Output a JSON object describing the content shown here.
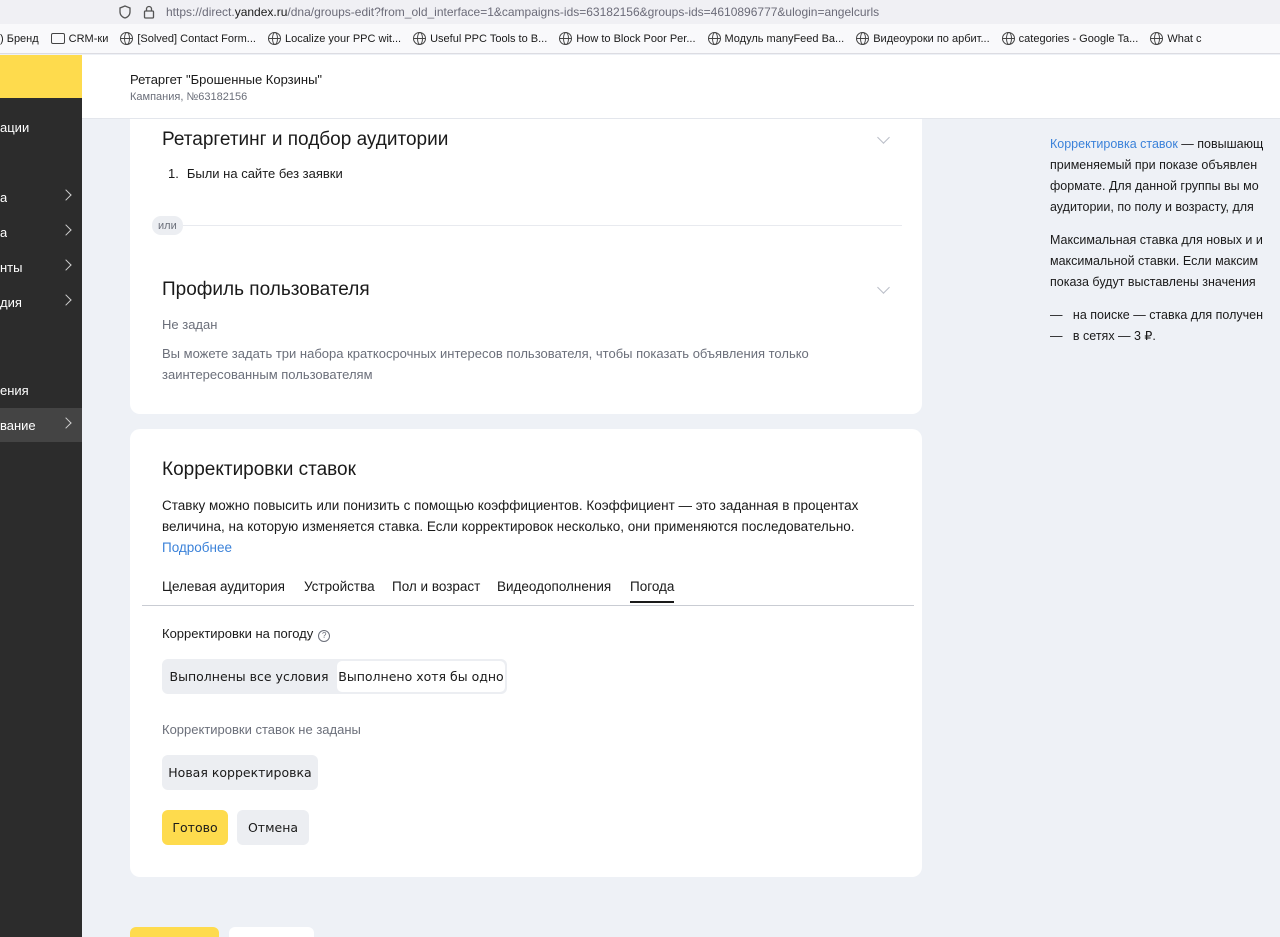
{
  "browser": {
    "url_prefix": "https://direct.",
    "url_host": "yandex.ru",
    "url_rest": "/dna/groups-edit?from_old_interface=1&campaigns-ids=63182156&groups-ids=4610896777&ulogin=angelcurls",
    "bookmarks": [
      {
        "label": ") Бренд",
        "icon": "none"
      },
      {
        "label": "CRM-ки",
        "icon": "folder"
      },
      {
        "label": "[Solved] Contact Form...",
        "icon": "globe"
      },
      {
        "label": "Localize your PPC wit...",
        "icon": "globe"
      },
      {
        "label": "Useful PPC Tools to B...",
        "icon": "globe"
      },
      {
        "label": "How to Block Poor Per...",
        "icon": "globe"
      },
      {
        "label": "Модуль manyFeed Ba...",
        "icon": "globe"
      },
      {
        "label": "Видеоуроки по арбит...",
        "icon": "globe"
      },
      {
        "label": "categories - Google Ta...",
        "icon": "globe"
      },
      {
        "label": "What c",
        "icon": "globe"
      }
    ]
  },
  "sidebar": {
    "items": [
      {
        "label": "ации",
        "chevron": false
      },
      {
        "label": "а",
        "chevron": true
      },
      {
        "label": "а",
        "chevron": true
      },
      {
        "label": "нты",
        "chevron": true
      },
      {
        "label": "дия",
        "chevron": true
      },
      {
        "label": "ения",
        "chevron": false
      },
      {
        "label": "вание",
        "chevron": true
      }
    ]
  },
  "header": {
    "title": "Ретаргет \"Брошенные Корзины\"",
    "subtitle": "Кампания, №63182156"
  },
  "retargeting": {
    "heading": "Ретаргетинг и подбор аудитории",
    "item_number": "1.",
    "item_text": "Были на сайте без заявки",
    "or_label": "или"
  },
  "profile": {
    "heading": "Профиль пользователя",
    "status": "Не задан",
    "desc_line1": "Вы можете задать три набора краткосрочных интересов пользователя, чтобы показать объявления только",
    "desc_line2": "заинтересованным пользователям"
  },
  "bid_adjustments": {
    "heading": "Корректировки ставок",
    "desc_line1": "Ставку можно повысить или понизить с помощью коэффициентов. Коэффициент — это заданная в процентах",
    "desc_line2": "величина, на которую изменяется ставка. Если корректировок несколько, они применяются последовательно.",
    "more_link": "Подробнее",
    "tabs": [
      "Целевая аудитория",
      "Устройства",
      "Пол и возраст",
      "Видеодополнения",
      "Погода"
    ],
    "active_tab": "Погода",
    "weather_label": "Корректировки на погоду",
    "help_glyph": "?",
    "condition_all": "Выполнены все условия",
    "condition_any": "Выполнено хотя бы одно",
    "selected_condition": "Выполнено хотя бы одно",
    "empty_text": "Корректировки ставок не заданы",
    "new_button": "Новая корректировка",
    "done_button": "Готово",
    "cancel_button": "Отмена"
  },
  "help_panel": {
    "link": "Корректировка ставок",
    "p1_rest": " — повышающ",
    "p1_line2": "применяемый при показе объявлен",
    "p1_line3": "формате. Для данной группы вы мо",
    "p1_line4": "аудитории, по полу и возрасту, для",
    "p2_line1": "Максимальная ставка для новых и и",
    "p2_line2": "максимальной ставки. Если максим",
    "p2_line3": "показа будут выставлены значения",
    "dash": "—",
    "bullet1": "на поиске — ставка для получен",
    "bullet2": "в сетях — 3 ₽."
  }
}
